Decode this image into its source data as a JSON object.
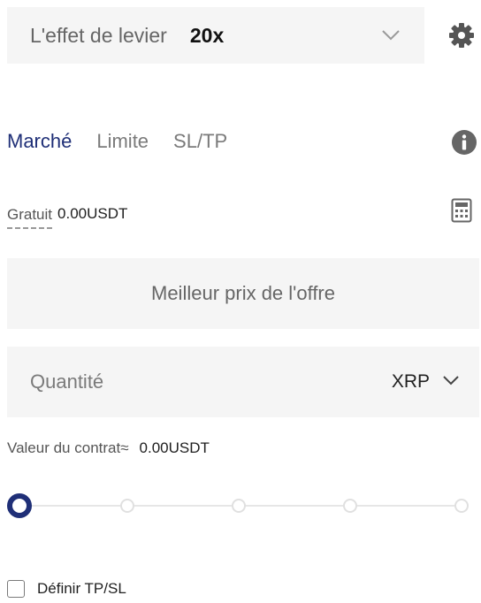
{
  "leverage": {
    "label": "L'effet de levier",
    "value": "20x",
    "chevron_icon": "chevron-down-icon",
    "settings_icon": "gear-icon"
  },
  "order_tabs": {
    "items": [
      {
        "label": "Marché",
        "active": true
      },
      {
        "label": "Limite",
        "active": false
      },
      {
        "label": "SL/TP",
        "active": false
      }
    ],
    "info_icon": "info-icon"
  },
  "available": {
    "label": "Gratuit",
    "value": "0.00USDT",
    "calculator_icon": "calculator-icon"
  },
  "price_field": {
    "text": "Meilleur prix de l'offre"
  },
  "quantity_field": {
    "placeholder": "Quantité",
    "value": "",
    "unit": "XRP",
    "unit_chevron_icon": "chevron-down-icon"
  },
  "contract_value": {
    "label": "Valeur du contrat≈",
    "value": "0.00USDT"
  },
  "slider": {
    "fraction": 0,
    "stops": 5
  },
  "tpsl_option": {
    "label": "Définir TP/SL",
    "checked": false
  },
  "colors": {
    "accent": "#1f2f77",
    "field_bg": "#f5f5f5",
    "muted_text": "#7a7a7a"
  }
}
